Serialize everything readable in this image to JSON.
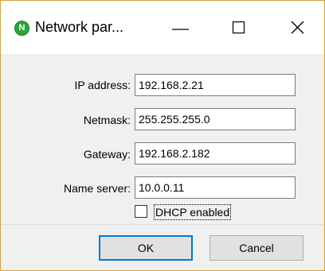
{
  "window": {
    "title": "Network par...",
    "icon": "app-icon-n",
    "icon_letter": "N",
    "accent_border": "#d6a33a",
    "icon_color": "#29a63a"
  },
  "caption_buttons": {
    "minimize": "minimize-icon",
    "maximize": "maximize-icon",
    "close": "close-icon"
  },
  "form": {
    "ip_address": {
      "label": "IP address:",
      "value": "192.168.2.21"
    },
    "netmask": {
      "label": "Netmask:",
      "value": "255.255.255.0"
    },
    "gateway": {
      "label": "Gateway:",
      "value": "192.168.2.182"
    },
    "name_server": {
      "label": "Name server:",
      "value": "10.0.0.11"
    },
    "dhcp": {
      "label": "DHCP enabled",
      "checked": false
    }
  },
  "buttons": {
    "ok": "OK",
    "cancel": "Cancel",
    "default_border": "#0078d7"
  }
}
